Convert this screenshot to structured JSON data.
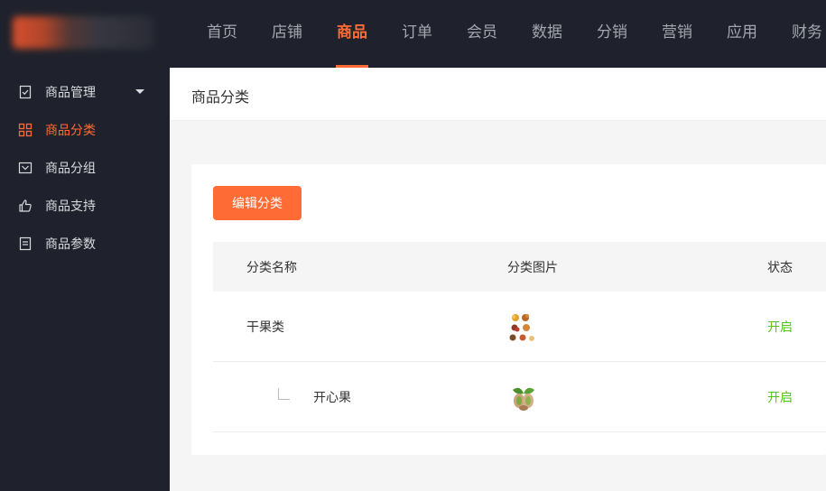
{
  "nav": {
    "items": [
      "首页",
      "店铺",
      "商品",
      "订单",
      "会员",
      "数据",
      "分销",
      "营销",
      "应用",
      "财务"
    ],
    "active": "商品"
  },
  "sidebar": {
    "items": [
      {
        "label": "商品管理",
        "icon": "clipboard-check-icon",
        "has_caret": true
      },
      {
        "label": "商品分类",
        "icon": "grid-icon",
        "active": true
      },
      {
        "label": "商品分组",
        "icon": "folder-icon"
      },
      {
        "label": "商品支持",
        "icon": "thumbs-up-icon"
      },
      {
        "label": "商品参数",
        "icon": "document-icon"
      }
    ]
  },
  "page": {
    "title": "商品分类",
    "edit_button_label": "编辑分类"
  },
  "table": {
    "headers": {
      "name": "分类名称",
      "image": "分类图片",
      "status": "状态"
    },
    "rows": [
      {
        "name": "干果类",
        "image": "dried-fruit-assortment",
        "status": "开启",
        "level": 0
      },
      {
        "name": "开心果",
        "image": "pistachio",
        "status": "开启",
        "level": 1
      }
    ]
  },
  "colors": {
    "accent": "#ff6b35",
    "status_on": "#52c41a",
    "dark_bg": "#1f222c"
  }
}
